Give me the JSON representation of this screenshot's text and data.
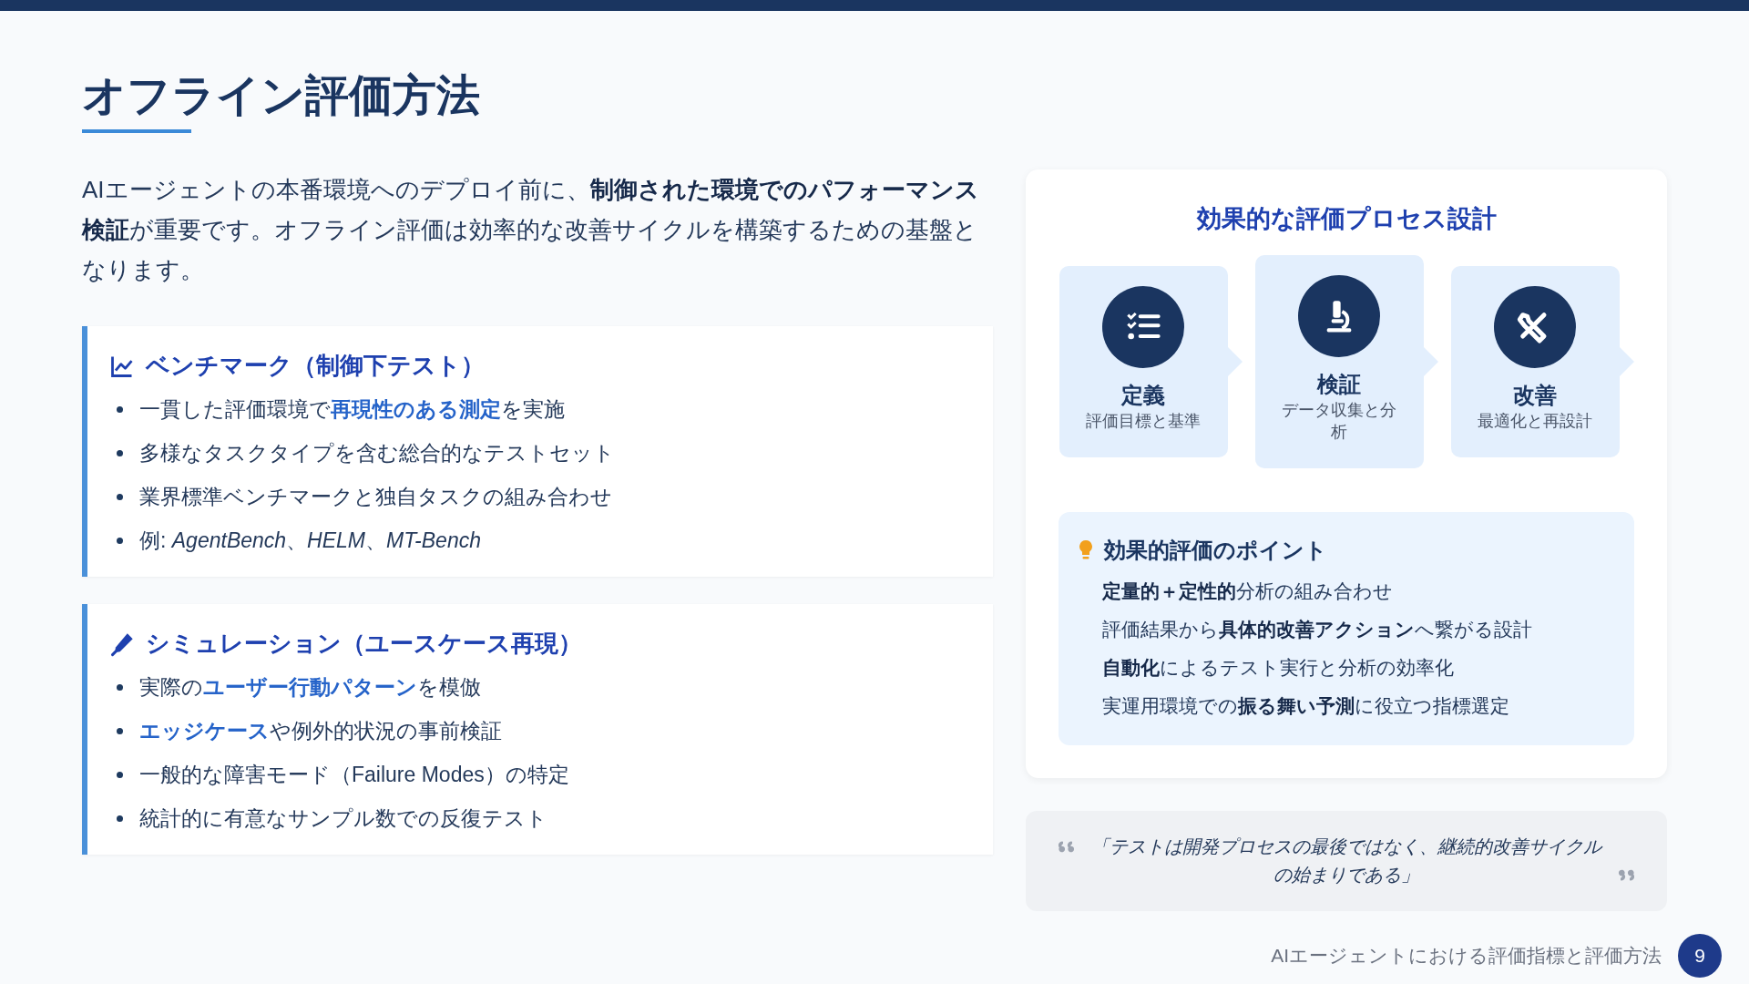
{
  "title": "オフライン評価方法",
  "intro": "AIエージェントの本番環境へのデプロイ前に、**制御された環境でのパフォーマンス検証**が重要です。オフライン評価は効率的な改善サイクルを構築するための基盤となります。",
  "sections": [
    {
      "heading": "ベンチマーク（制御下テスト）",
      "bullets": [
        [
          {
            "kind": "plain",
            "text": "一貫した評価環境で"
          },
          {
            "kind": "highlight",
            "text": "再現性のある測定"
          },
          {
            "kind": "plain",
            "text": "を実施"
          }
        ],
        [
          {
            "kind": "plain",
            "text": "多様なタスクタイプを含む総合的なテストセット"
          }
        ],
        [
          {
            "kind": "plain",
            "text": "業界標準ベンチマークと独自タスクの組み合わせ"
          }
        ],
        [
          {
            "kind": "plain",
            "text": "例: "
          },
          {
            "kind": "italic",
            "text": "AgentBench"
          },
          {
            "kind": "plain",
            "text": "、"
          },
          {
            "kind": "italic",
            "text": "HELM"
          },
          {
            "kind": "plain",
            "text": "、"
          },
          {
            "kind": "italic",
            "text": "MT-Bench"
          }
        ]
      ]
    },
    {
      "heading": "シミュレーション（ユースケース再現）",
      "bullets": [
        [
          {
            "kind": "plain",
            "text": "実際の"
          },
          {
            "kind": "highlight",
            "text": "ユーザー行動パターン"
          },
          {
            "kind": "plain",
            "text": "を模倣"
          }
        ],
        [
          {
            "kind": "highlight",
            "text": "エッジケース"
          },
          {
            "kind": "plain",
            "text": "や例外的状況の事前検証"
          }
        ],
        [
          {
            "kind": "plain",
            "text": "一般的な障害モード（Failure Modes）の特定"
          }
        ],
        [
          {
            "kind": "plain",
            "text": "統計的に有意なサンプル数での反復テスト"
          }
        ]
      ]
    }
  ],
  "process": {
    "title": "効果的な評価プロセス設計",
    "steps": [
      {
        "label": "定義",
        "sub": "評価目標と基準",
        "raised": false
      },
      {
        "label": "検証",
        "sub": "データ収集と分析",
        "raised": true
      },
      {
        "label": "改善",
        "sub": "最適化と再設計",
        "raised": false
      }
    ],
    "tips": {
      "heading": "効果的評価のポイント",
      "items": [
        "**定量的＋定性的**分析の組み合わせ",
        "評価結果から**具体的改善アクション**へ繋がる設計",
        "**自動化**によるテスト実行と分析の効率化",
        "実運用環境での**振る舞い予測**に役立つ指標選定"
      ]
    }
  },
  "quote": "「テストは開発プロセスの最後ではなく、継続的改善サイクルの始まりである」",
  "footer": {
    "text": "AIエージェントにおける評価指標と評価方法",
    "page": "9"
  }
}
